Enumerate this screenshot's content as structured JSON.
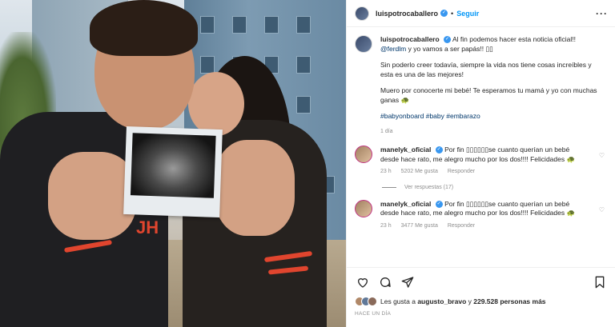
{
  "post": {
    "username": "luispotrocaballero",
    "follow_label": "Seguir",
    "dot": "•",
    "more_label": "···"
  },
  "caption": {
    "username": "luispotrocaballero",
    "line1": "Al fin podemos hacer esta noticia oficial!!",
    "mention": "@ferdlm",
    "line1b": "y yo vamos a ser papás!! ▯▯",
    "para2": "Sin poderlo creer todavía, siempre la vida nos tiene cosas increíbles y esta es una de las mejores!",
    "para3": "Muero por conocerte mi bebé! Te esperamos tu mamá y yo con muchas ganas 🐢",
    "hashtags": "#babyonboard #baby #embarazo",
    "age": "1 día"
  },
  "comments": [
    {
      "username": "manelyk_oficial",
      "text": "Por fin ▯▯▯▯▯▯se cuanto querían un bebé desde hace rato, me alegro mucho por los dos!!!! Felicidades 🐢",
      "time": "23 h",
      "likes": "5202 Me gusta",
      "reply": "Responder"
    },
    {
      "username": "manelyk_oficial",
      "text": "Por fin ▯▯▯▯▯▯se cuanto querían un bebé desde hace rato, me alegro mucho por los dos!!!! Felicidades 🐢",
      "time": "23 h",
      "likes": "3477 Me gusta",
      "reply": "Responder"
    }
  ],
  "replies_label": "Ver respuestas (17)",
  "likes": {
    "prefix": "Les gusta a",
    "user": "augusto_bravo",
    "middle": "y",
    "count": "229.528 personas más"
  },
  "timestamp": "HACE UN DÍA",
  "photo": {
    "shirt_text": "JH"
  }
}
